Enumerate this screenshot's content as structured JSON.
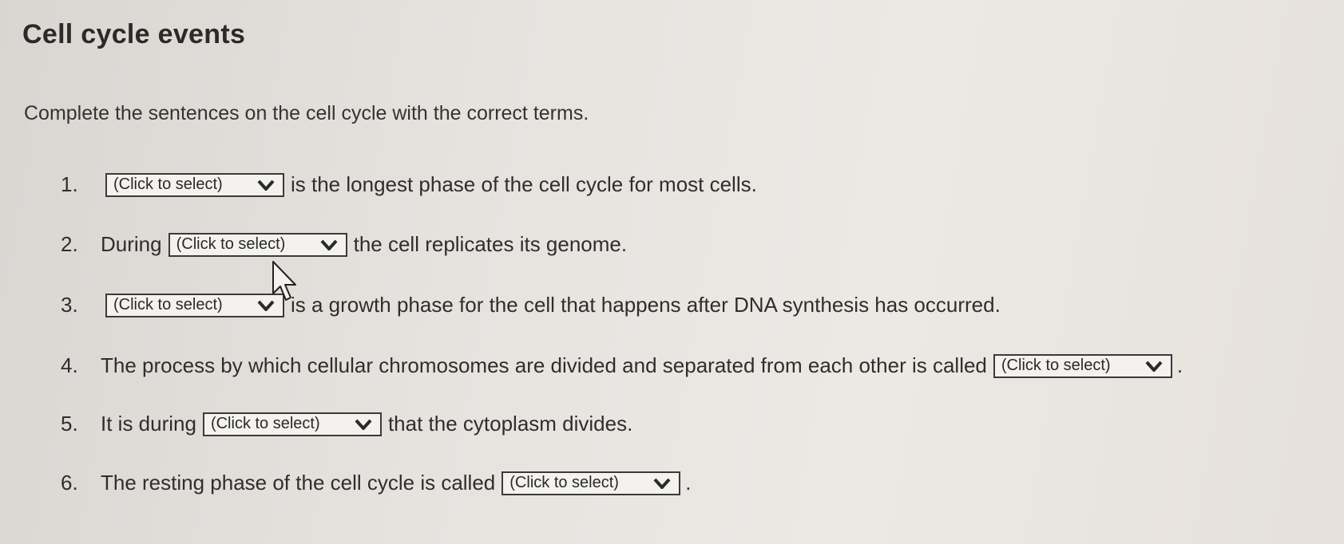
{
  "title": "Cell cycle events",
  "instructions": "Complete the sentences on the cell cycle with the correct terms.",
  "select_label": "(Click to select)",
  "items": [
    {
      "num": "1.",
      "before": "",
      "after": "is the longest phase of the cell cycle for most cells."
    },
    {
      "num": "2.",
      "before": "During",
      "after": "the cell replicates its genome."
    },
    {
      "num": "3.",
      "before": "",
      "after": "is a growth phase for the cell that happens after DNA synthesis has occurred."
    },
    {
      "num": "4.",
      "before": "The process by which cellular chromosomes are divided and separated from each other is called",
      "after": "."
    },
    {
      "num": "5.",
      "before": "It is during",
      "after": "that the cytoplasm divides."
    },
    {
      "num": "6.",
      "before": "The resting phase of the cell cycle is called",
      "after": "."
    }
  ]
}
